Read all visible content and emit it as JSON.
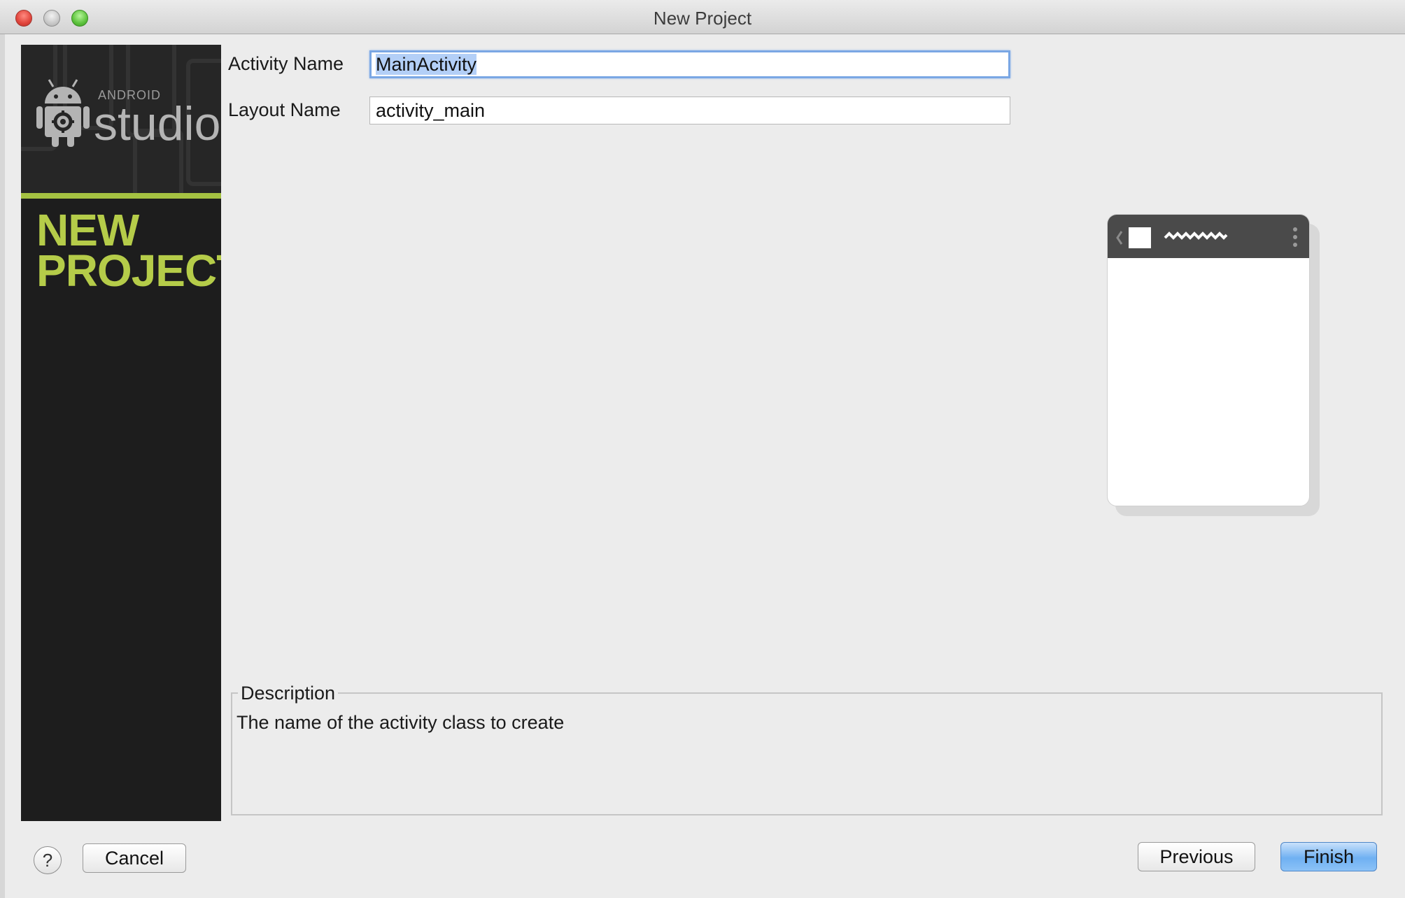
{
  "window": {
    "title": "New Project"
  },
  "sidebar": {
    "logo_small": "ANDROID",
    "logo_large": "studio",
    "title": "NEW\nPROJECT"
  },
  "form": {
    "activity_name": {
      "label": "Activity Name",
      "value": "MainActivity"
    },
    "layout_name": {
      "label": "Layout Name",
      "value": "activity_main"
    }
  },
  "description": {
    "title": "Description",
    "text": "The name of the activity class to create"
  },
  "buttons": {
    "help": "?",
    "cancel": "Cancel",
    "previous": "Previous",
    "finish": "Finish"
  },
  "colors": {
    "accent_green": "#a5c242",
    "sidebar_bg": "#1d1d1d",
    "selection": "#b3cff7",
    "default_button": "#6fb0f2"
  }
}
